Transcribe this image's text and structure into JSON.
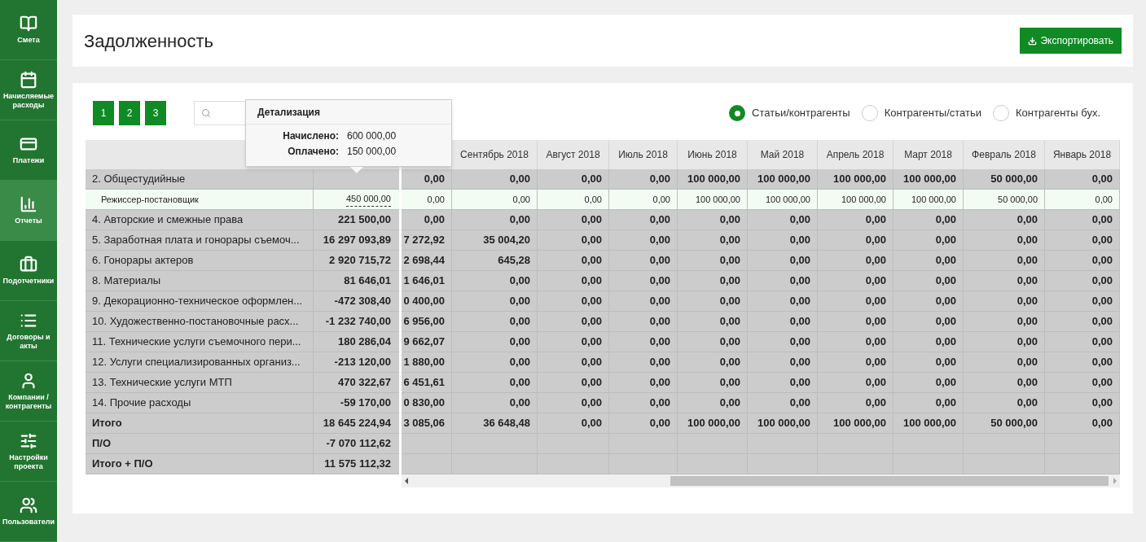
{
  "sidebar": {
    "items": [
      {
        "label": "Смета",
        "selected": false
      },
      {
        "label": "Начисляемые расходы",
        "selected": false
      },
      {
        "label": "Платежи",
        "selected": false
      },
      {
        "label": "Отчеты",
        "selected": true
      },
      {
        "label": "Подотчетники",
        "selected": false
      },
      {
        "label": "Договоры и акты",
        "selected": false
      },
      {
        "label": "Компании / контрагенты",
        "selected": false
      },
      {
        "label": "Настройки проекта",
        "selected": false
      },
      {
        "label": "Пользователи",
        "selected": false
      }
    ]
  },
  "header": {
    "title": "Задолженность",
    "export_button": "Экспортировать"
  },
  "levels": [
    {
      "label": "1"
    },
    {
      "label": "2"
    },
    {
      "label": "3"
    }
  ],
  "modes": [
    {
      "label": "Статьи/контрагенты",
      "selected": true
    },
    {
      "label": "Контрагенты/статьи",
      "selected": false
    },
    {
      "label": "Контрагенты бух.",
      "selected": false
    }
  ],
  "tooltip": {
    "title": "Детализация",
    "lines": [
      {
        "label": "Начислено:",
        "value": "600 000,00"
      },
      {
        "label": "Оплачено:",
        "value": "150 000,00"
      }
    ]
  },
  "table": {
    "columns": [
      null,
      "Сентябрь 2018",
      "Август 2018",
      "Июль 2018",
      "Июнь 2018",
      "Май 2018",
      "Апрель 2018",
      "Март 2018",
      "Февраль 2018",
      "Январь 2018"
    ],
    "rows": [
      {
        "kind": "group",
        "name": "2. Общестудийные",
        "total": null,
        "cells": [
          "0,00",
          "0,00",
          "0,00",
          "0,00",
          "100 000,00",
          "100 000,00",
          "100 000,00",
          "100 000,00",
          "50 000,00",
          "0,00"
        ]
      },
      {
        "kind": "item",
        "name": "Режиссер-постановщик",
        "total": "450 000,00",
        "cells": [
          "0,00",
          "0,00",
          "0,00",
          "0,00",
          "100 000,00",
          "100 000,00",
          "100 000,00",
          "100 000,00",
          "50 000,00",
          "0,00"
        ]
      },
      {
        "kind": "group",
        "name": "4. Авторские и смежные права",
        "total": "221 500,00",
        "cells": [
          "0,00",
          "0,00",
          "0,00",
          "0,00",
          "0,00",
          "0,00",
          "0,00",
          "0,00",
          "0,00",
          "0,00"
        ]
      },
      {
        "kind": "group",
        "name": "5. Заработная плата и гонорары съемоч...",
        "total": "16 297 093,89",
        "cells": [
          "7 272,92",
          "35 004,20",
          "0,00",
          "0,00",
          "0,00",
          "0,00",
          "0,00",
          "0,00",
          "0,00",
          "0,00"
        ]
      },
      {
        "kind": "group",
        "name": "6. Гонорары актеров",
        "total": "2 920 715,72",
        "cells": [
          "2 698,44",
          "645,28",
          "0,00",
          "0,00",
          "0,00",
          "0,00",
          "0,00",
          "0,00",
          "0,00",
          "0,00"
        ]
      },
      {
        "kind": "group",
        "name": "8. Материалы",
        "total": "81 646,01",
        "cells": [
          "1 646,01",
          "0,00",
          "0,00",
          "0,00",
          "0,00",
          "0,00",
          "0,00",
          "0,00",
          "0,00",
          "0,00"
        ]
      },
      {
        "kind": "group",
        "name": "9. Декорационно-техническое оформлен...",
        "total": "-472 308,40",
        "cells": [
          "0 400,00",
          "0,00",
          "0,00",
          "0,00",
          "0,00",
          "0,00",
          "0,00",
          "0,00",
          "0,00",
          "0,00"
        ]
      },
      {
        "kind": "group",
        "name": "10. Художественно-постановочные расх...",
        "total": "-1 232 740,00",
        "cells": [
          "6 956,00",
          "0,00",
          "0,00",
          "0,00",
          "0,00",
          "0,00",
          "0,00",
          "0,00",
          "0,00",
          "0,00"
        ]
      },
      {
        "kind": "group",
        "name": "11. Технические услуги съемочного пери...",
        "total": "180 286,04",
        "cells": [
          "9 662,07",
          "0,00",
          "0,00",
          "0,00",
          "0,00",
          "0,00",
          "0,00",
          "0,00",
          "0,00",
          "0,00"
        ]
      },
      {
        "kind": "group",
        "name": "12. Услуги специализированных организ...",
        "total": "-213 120,00",
        "cells": [
          "1 880,00",
          "0,00",
          "0,00",
          "0,00",
          "0,00",
          "0,00",
          "0,00",
          "0,00",
          "0,00",
          "0,00"
        ]
      },
      {
        "kind": "group",
        "name": "13. Технические услуги МТП",
        "total": "470 322,67",
        "cells": [
          "6 451,61",
          "0,00",
          "0,00",
          "0,00",
          "0,00",
          "0,00",
          "0,00",
          "0,00",
          "0,00",
          "0,00"
        ]
      },
      {
        "kind": "group",
        "name": "14. Прочие расходы",
        "total": "-59 170,00",
        "cells": [
          "0 830,00",
          "0,00",
          "0,00",
          "0,00",
          "0,00",
          "0,00",
          "0,00",
          "0,00",
          "0,00",
          "0,00"
        ]
      },
      {
        "kind": "total",
        "name": "Итого",
        "total": "18 645 224,94",
        "cells": [
          "3 085,06",
          "36 648,48",
          "0,00",
          "0,00",
          "100 000,00",
          "100 000,00",
          "100 000,00",
          "100 000,00",
          "50 000,00",
          "0,00"
        ]
      },
      {
        "kind": "total",
        "name": "П/О",
        "total": "-7 070 112,62",
        "cells": [
          null,
          null,
          null,
          null,
          null,
          null,
          null,
          null,
          null,
          null
        ]
      },
      {
        "kind": "total",
        "name": "Итого + П/О",
        "total": "11 575 112,32",
        "cells": [
          null,
          null,
          null,
          null,
          null,
          null,
          null,
          null,
          null,
          null
        ]
      }
    ]
  }
}
